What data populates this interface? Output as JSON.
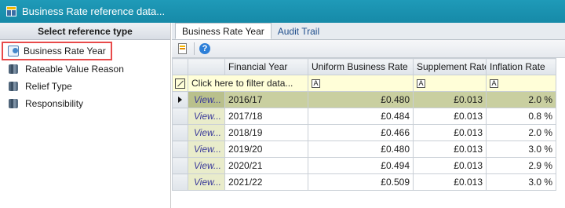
{
  "window": {
    "title": "Business Rate reference data...",
    "icon": "table-icon"
  },
  "left_pane": {
    "header": "Select reference type",
    "items": [
      {
        "label": "Business Rate Year",
        "icon": "business-rate-year-icon",
        "selected": true
      },
      {
        "label": "Rateable Value Reason",
        "icon": "database-icon"
      },
      {
        "label": "Relief Type",
        "icon": "database-icon"
      },
      {
        "label": "Responsibility",
        "icon": "database-icon"
      }
    ]
  },
  "tabs": [
    {
      "label": "Business Rate Year",
      "active": true
    },
    {
      "label": "Audit Trail",
      "active": false
    }
  ],
  "toolbar": {
    "buttons": [
      "new-record-icon",
      "help-icon"
    ]
  },
  "grid": {
    "columns": [
      "",
      "Financial Year",
      "Uniform Business Rate",
      "Supplement Rate",
      "Inflation Rate"
    ],
    "filter_placeholder": "Click here to filter data...",
    "filter_box_glyph": "A",
    "rows": [
      {
        "view": "View...",
        "financial_year": "2016/17",
        "uniform_business_rate": "£0.480",
        "supplement_rate": "£0.013",
        "inflation_rate": "2.0 %"
      },
      {
        "view": "View...",
        "financial_year": "2017/18",
        "uniform_business_rate": "£0.484",
        "supplement_rate": "£0.013",
        "inflation_rate": "0.8 %"
      },
      {
        "view": "View...",
        "financial_year": "2018/19",
        "uniform_business_rate": "£0.466",
        "supplement_rate": "£0.013",
        "inflation_rate": "2.0 %"
      },
      {
        "view": "View...",
        "financial_year": "2019/20",
        "uniform_business_rate": "£0.480",
        "supplement_rate": "£0.013",
        "inflation_rate": "3.0 %"
      },
      {
        "view": "View...",
        "financial_year": "2020/21",
        "uniform_business_rate": "£0.494",
        "supplement_rate": "£0.013",
        "inflation_rate": "2.9 %"
      },
      {
        "view": "View...",
        "financial_year": "2021/22",
        "uniform_business_rate": "£0.509",
        "supplement_rate": "£0.013",
        "inflation_rate": "3.0 %"
      }
    ]
  },
  "colors": {
    "titlebar": "#168aa8",
    "selection_outline": "#e84a4a",
    "selected_row": "#c9cfa0",
    "filter_row": "#fffed8"
  }
}
